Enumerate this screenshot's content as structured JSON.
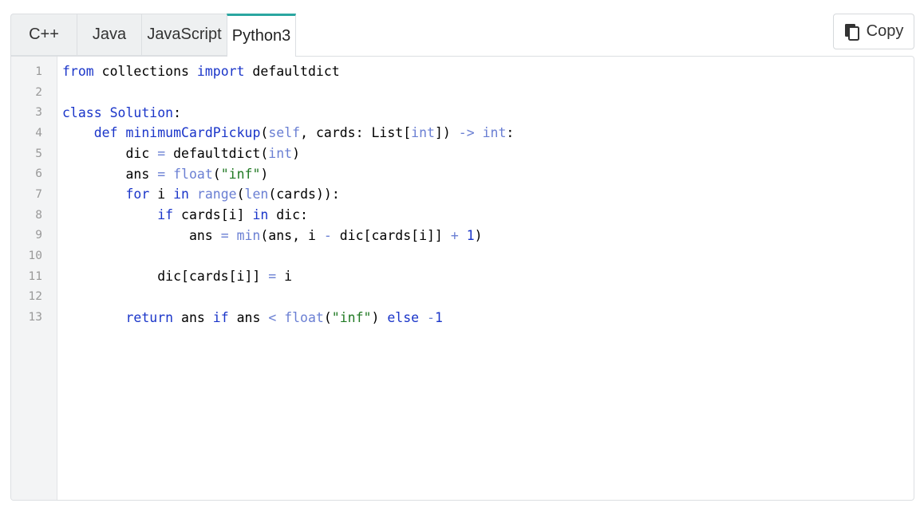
{
  "tabs": [
    {
      "label": "C++",
      "active": false
    },
    {
      "label": "Java",
      "active": false
    },
    {
      "label": "JavaScript",
      "active": false
    },
    {
      "label": "Python3",
      "active": true
    }
  ],
  "copy_button": {
    "label": "Copy",
    "icon": "copy-icon"
  },
  "colors": {
    "active_tab_accent": "#2aa6a0",
    "keyword": "#1a35c9",
    "builtin": "#6a7fd3",
    "string": "#217a24"
  },
  "code": {
    "language": "Python3",
    "line_numbers": [
      "1",
      "2",
      "3",
      "4",
      "5",
      "6",
      "7",
      "8",
      "9",
      "10",
      "11",
      "12",
      "13"
    ],
    "lines": [
      "from collections import defaultdict",
      "",
      "class Solution:",
      "    def minimumCardPickup(self, cards: List[int]) -> int:",
      "        dic = defaultdict(int)",
      "        ans = float(\"inf\")",
      "        for i in range(len(cards)):",
      "            if cards[i] in dic:",
      "                ans = min(ans, i - dic[cards[i]] + 1)",
      "",
      "            dic[cards[i]] = i",
      "",
      "        return ans if ans < float(\"inf\") else -1"
    ]
  }
}
